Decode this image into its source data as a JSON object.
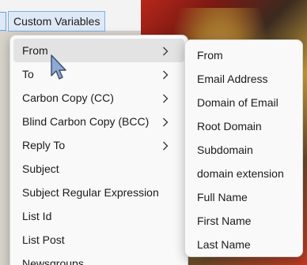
{
  "toolbar": {
    "custom_variables_label": "Custom Variables"
  },
  "main_menu": {
    "items": [
      {
        "label": "From",
        "has_submenu": true,
        "active": true
      },
      {
        "label": "To",
        "has_submenu": true
      },
      {
        "label": "Carbon Copy (CC)",
        "has_submenu": true
      },
      {
        "label": "Blind Carbon Copy (BCC)",
        "has_submenu": true
      },
      {
        "label": "Reply To",
        "has_submenu": true
      },
      {
        "label": "Subject"
      },
      {
        "label": "Subject Regular Expression"
      },
      {
        "label": "List Id"
      },
      {
        "label": "List Post"
      },
      {
        "label": "Newsgroups"
      }
    ]
  },
  "sub_menu": {
    "items": [
      {
        "label": "From"
      },
      {
        "label": "Email Address"
      },
      {
        "label": "Domain of Email"
      },
      {
        "label": "Root Domain"
      },
      {
        "label": "Subdomain"
      },
      {
        "label": "domain extension"
      },
      {
        "label": "Full Name"
      },
      {
        "label": "First Name"
      },
      {
        "label": "Last Name"
      }
    ]
  }
}
